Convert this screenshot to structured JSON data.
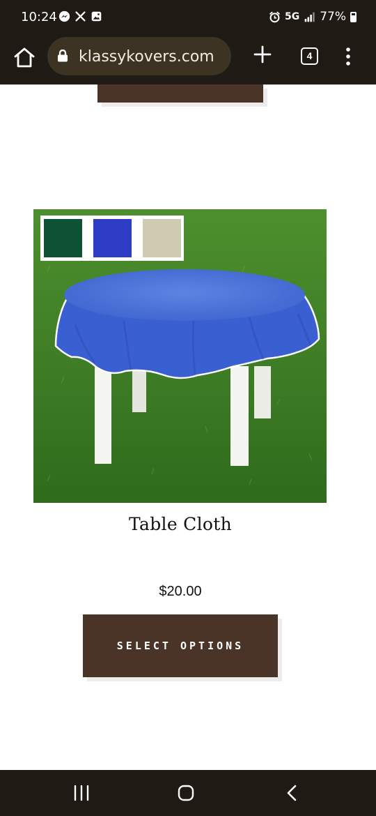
{
  "status_bar": {
    "time": "10:24",
    "app_icons": [
      "messenger-icon",
      "x-icon",
      "gallery-icon"
    ],
    "alarm_icon": "alarm-icon",
    "network": "5G",
    "signal_icon": "signal-icon",
    "battery_percent": "77%"
  },
  "browser": {
    "url": "klassykovers.com",
    "tab_count": "4",
    "icons": [
      "home-icon",
      "lock-icon",
      "plus-icon",
      "tabs-icon",
      "more-vert-icon"
    ]
  },
  "product": {
    "title": "Table Cloth",
    "price": "$20.00",
    "button_label": "SELECT OPTIONS",
    "swatch_colors": [
      "#0e5235",
      "#2f3dc4",
      "#cfcab2"
    ]
  },
  "colors": {
    "bar_background": "#1f1a14",
    "url_bar": "#3d3322",
    "button_brown": "#4a3427"
  },
  "nav_bar": {
    "icons": [
      "recent-apps-icon",
      "home-circle-icon",
      "back-icon"
    ]
  }
}
